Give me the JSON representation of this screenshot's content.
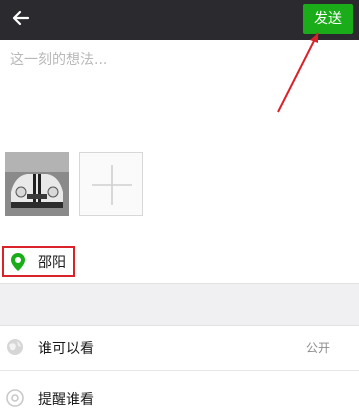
{
  "header": {
    "send_label": "发送"
  },
  "composer": {
    "placeholder": "这一刻的想法..."
  },
  "location": {
    "label": "邵阳"
  },
  "settings": [
    {
      "label": "谁可以看",
      "value": "公开"
    },
    {
      "label": "提醒谁看",
      "value": ""
    }
  ]
}
